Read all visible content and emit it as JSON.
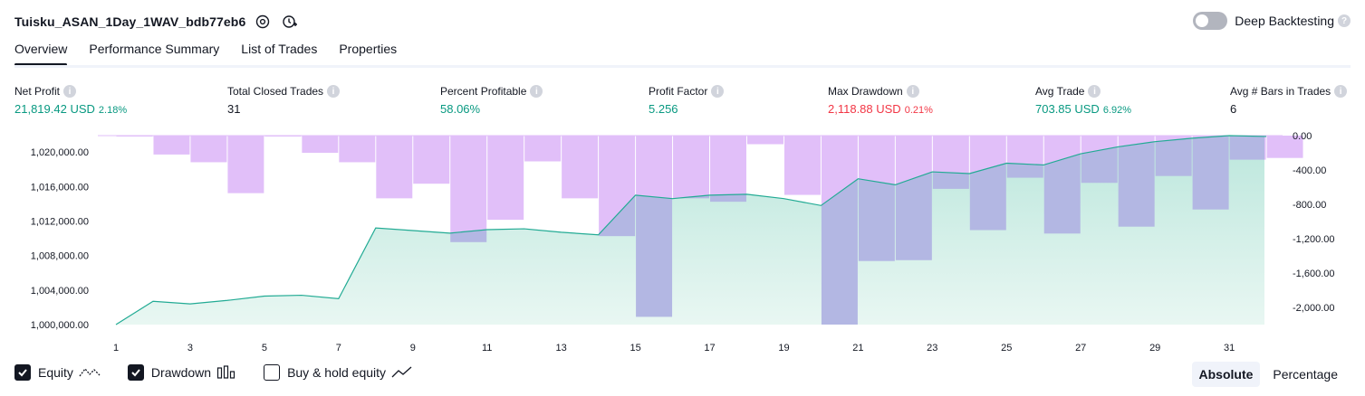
{
  "header": {
    "strategy_name": "Tuisku_ASAN_1Day_1WAV_bdb77eb6",
    "deep_backtesting_label": "Deep Backtesting",
    "deep_backtesting_enabled": false
  },
  "tabs": [
    {
      "label": "Overview",
      "active": true
    },
    {
      "label": "Performance Summary",
      "active": false
    },
    {
      "label": "List of Trades",
      "active": false
    },
    {
      "label": "Properties",
      "active": false
    }
  ],
  "metrics": [
    {
      "label": "Net Profit",
      "value": "21,819.42 USD",
      "pct": "2.18%",
      "color": "green"
    },
    {
      "label": "Total Closed Trades",
      "value": "31",
      "pct": "",
      "color": "dark"
    },
    {
      "label": "Percent Profitable",
      "value": "58.06%",
      "pct": "",
      "color": "green"
    },
    {
      "label": "Profit Factor",
      "value": "5.256",
      "pct": "",
      "color": "green"
    },
    {
      "label": "Max Drawdown",
      "value": "2,118.88 USD",
      "pct": "0.21%",
      "color": "red"
    },
    {
      "label": "Avg Trade",
      "value": "703.85 USD",
      "pct": "6.92%",
      "color": "green"
    },
    {
      "label": "Avg # Bars in Trades",
      "value": "6",
      "pct": "",
      "color": "dark"
    }
  ],
  "legend": {
    "equity_label": "Equity",
    "drawdown_label": "Drawdown",
    "buyhold_label": "Buy & hold equity",
    "equity_checked": true,
    "drawdown_checked": true,
    "buyhold_checked": false
  },
  "mode": {
    "absolute_label": "Absolute",
    "percentage_label": "Percentage",
    "active": "Absolute"
  },
  "colors": {
    "equity_line": "#22ab94",
    "equity_fill": "#c8ebe4",
    "drawdown_fill": "#e1bff9",
    "drawdown_overlap": "#b3b7e3",
    "positive": "#089981",
    "negative": "#f23645"
  },
  "chart_data": {
    "type": "area",
    "x_ticks": [
      1,
      3,
      5,
      7,
      9,
      11,
      13,
      15,
      17,
      19,
      21,
      23,
      25,
      27,
      29,
      31
    ],
    "left_axis": {
      "ticks": [
        "1,000,000.00",
        "1,004,000.00",
        "1,008,000.00",
        "1,012,000.00",
        "1,016,000.00",
        "1,020,000.00"
      ],
      "tick_values": [
        1000000,
        1004000,
        1008000,
        1012000,
        1016000,
        1020000
      ],
      "ylim": [
        1000000,
        1021900
      ]
    },
    "right_axis": {
      "ticks": [
        "0.00",
        "-400.00",
        "-800.00",
        "-1,200.00",
        "-1,600.00",
        "-2,000.00"
      ],
      "tick_values": [
        0,
        -400,
        -800,
        -1200,
        -1600,
        -2000
      ],
      "ylim": [
        -2200,
        0
      ]
    },
    "series": [
      {
        "name": "Equity",
        "x": [
          1,
          2,
          3,
          4,
          5,
          6,
          7,
          8,
          9,
          10,
          11,
          12,
          13,
          14,
          15,
          16,
          17,
          18,
          19,
          20,
          21,
          22,
          23,
          24,
          25,
          26,
          27,
          28,
          29,
          30,
          31,
          32
        ],
        "values": [
          1000000,
          1002700,
          1002400,
          1002800,
          1003300,
          1003400,
          1003000,
          1011200,
          1010900,
          1010600,
          1011000,
          1011100,
          1010700,
          1010400,
          1015000,
          1014600,
          1015000,
          1015100,
          1014600,
          1013800,
          1016900,
          1016200,
          1017700,
          1017500,
          1018700,
          1018500,
          1019800,
          1020600,
          1021200,
          1021600,
          1021900,
          1021800
        ]
      },
      {
        "name": "Drawdown",
        "x": [
          1,
          2,
          3,
          4,
          5,
          6,
          7,
          8,
          9,
          10,
          11,
          12,
          13,
          14,
          15,
          16,
          17,
          18,
          19,
          20,
          21,
          22,
          23,
          24,
          25,
          26,
          27,
          28,
          29,
          30,
          31,
          32
        ],
        "values": [
          -5,
          -220,
          -310,
          -670,
          -5,
          -200,
          -310,
          -730,
          -560,
          -1240,
          -980,
          -300,
          -730,
          -1170,
          -2110,
          -730,
          -770,
          -100,
          -690,
          -2200,
          -1460,
          -1450,
          -620,
          -1100,
          -490,
          -1140,
          -550,
          -1060,
          -470,
          -860,
          -280,
          -260
        ]
      }
    ],
    "grid": false,
    "legend_position": "bottom-left"
  }
}
